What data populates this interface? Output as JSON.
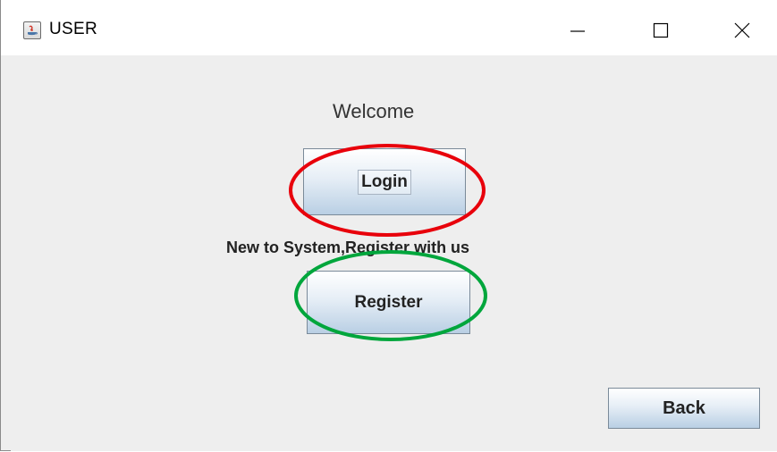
{
  "window": {
    "title": "USER",
    "controls": {
      "minimize_icon": "minimize-icon",
      "maximize_icon": "maximize-icon",
      "close_icon": "close-icon"
    }
  },
  "main": {
    "welcome_text": "Welcome",
    "login_label": "Login",
    "register_hint": "New to System,Register with us",
    "register_label": "Register",
    "back_label": "Back"
  },
  "annotations": {
    "login_highlight_color": "#e8000b",
    "register_highlight_color": "#00a63c"
  },
  "colors": {
    "content_background": "#eeeeee",
    "button_gradient_top": "#ffffff",
    "button_gradient_bottom": "#b9cfe4"
  }
}
